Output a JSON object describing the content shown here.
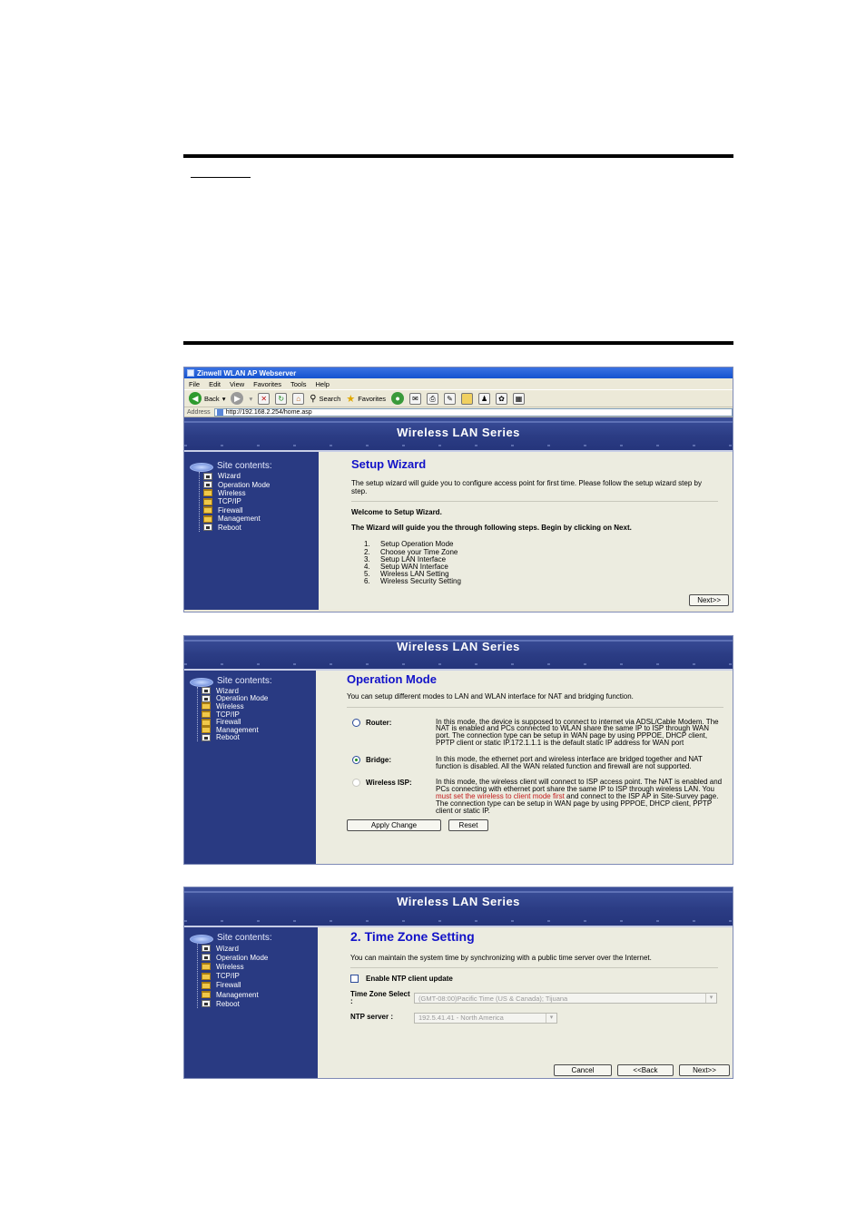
{
  "browser": {
    "window_title": "Zinwell WLAN AP Webserver",
    "menu": [
      "File",
      "Edit",
      "View",
      "Favorites",
      "Tools",
      "Help"
    ],
    "back_label": "Back",
    "search_label": "Search",
    "favorites_label": "Favorites",
    "address_label": "Address",
    "address_url": "http://192.168.2.254/home.asp"
  },
  "banner_title": "Wireless LAN Series",
  "sidebar": {
    "header": "Site contents:",
    "items": [
      {
        "label": "Wizard",
        "icon": "page-icon"
      },
      {
        "label": "Operation Mode",
        "icon": "page-icon"
      },
      {
        "label": "Wireless",
        "icon": "folder-icon"
      },
      {
        "label": "TCP/IP",
        "icon": "folder-icon"
      },
      {
        "label": "Firewall",
        "icon": "folder-icon"
      },
      {
        "label": "Management",
        "icon": "folder-icon"
      },
      {
        "label": "Reboot",
        "icon": "page-icon"
      }
    ]
  },
  "wizard": {
    "title": "Setup Wizard",
    "intro": "The setup wizard will guide you to configure access point for first time. Please follow the setup wizard step by step.",
    "welcome": "Welcome to Setup Wizard.",
    "guide": "The Wizard will guide you the through following steps. Begin by clicking on Next.",
    "steps": [
      {
        "n": "1.",
        "label": "Setup Operation Mode"
      },
      {
        "n": "2.",
        "label": "Choose your Time Zone"
      },
      {
        "n": "3.",
        "label": "Setup LAN Interface"
      },
      {
        "n": "4.",
        "label": "Setup WAN Interface"
      },
      {
        "n": "5.",
        "label": "Wireless LAN Setting"
      },
      {
        "n": "6.",
        "label": "Wireless Security Setting"
      }
    ],
    "next_label": "Next>>"
  },
  "opmode": {
    "title": "Operation Mode",
    "intro": "You can setup different modes to LAN and WLAN interface for NAT and bridging function.",
    "router_label": "Router:",
    "router_desc": "In this mode, the device is supposed to connect to internet via ADSL/Cable Modem. The NAT is enabled and PCs connected to WLAN share the same IP to ISP through WAN port. The connection type can be setup in WAN page by using PPPOE, DHCP client, PPTP client or static IP.172.1.1.1 is the default static IP address for WAN port",
    "bridge_label": "Bridge:",
    "bridge_desc": "In this mode, the ethernet port and wireless interface are bridged together and NAT function is disabled. All the WAN related function and firewall are not supported.",
    "wisp_label": "Wireless ISP:",
    "wisp_desc_a": "In this mode, the wireless client will connect to ISP access point. The NAT is enabled and PCs connecting with ethernet port share the same IP to ISP through wireless LAN. You ",
    "wisp_desc_red": "must set the wireless to client mode first",
    "wisp_desc_b": " and connect to the ISP AP in Site-Survey page. The connection type can be setup in WAN page by using PPPOE, DHCP client, PPTP client or static IP.",
    "apply_label": "Apply Change",
    "reset_label": "Reset"
  },
  "timezone": {
    "title": "2. Time Zone Setting",
    "intro": "You can maintain the system time by synchronizing with a public time server over the Internet.",
    "ntp_check_label": "Enable NTP client update",
    "tz_label": "Time Zone Select :",
    "tz_value": "(GMT-08:00)Pacific Time (US & Canada); Tijuana",
    "ntp_label": "NTP server :",
    "ntp_value": "192.5.41.41 - North America",
    "cancel_label": "Cancel",
    "back_label": "<<Back",
    "next_label": "Next>>"
  }
}
